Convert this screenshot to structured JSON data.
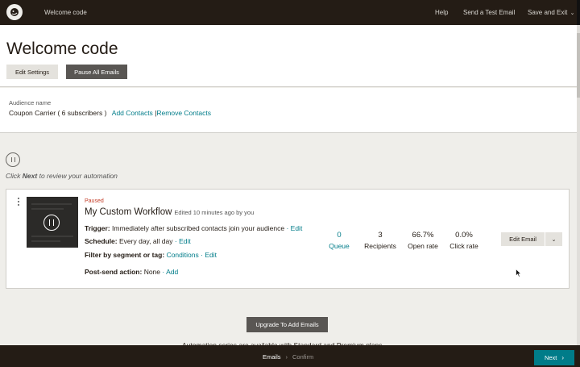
{
  "topbar": {
    "breadcrumb": "Welcome code",
    "help": "Help",
    "send_test": "Send a Test Email",
    "save_exit": "Save and Exit",
    "save_exit_chevron": "⌄"
  },
  "header": {
    "title": "Welcome code",
    "edit_settings": "Edit Settings",
    "pause_all": "Pause All Emails"
  },
  "audience": {
    "label": "Audience name",
    "name": "Coupon Carrier ( 6 subscribers )",
    "add_contacts": "Add Contacts",
    "divider": "|",
    "remove_contacts": "Remove Contacts"
  },
  "review": {
    "prefix": "Click ",
    "bold": "Next",
    "suffix": " to review your automation"
  },
  "email_card": {
    "status": "Paused",
    "title": "My Custom Workflow",
    "edited": "Edited 10 minutes ago by you",
    "trigger_label": "Trigger:",
    "trigger_value": "Immediately after subscribed contacts join your audience",
    "trigger_edit": "Edit",
    "schedule_label": "Schedule:",
    "schedule_value": "Every day, all day",
    "schedule_edit": "Edit",
    "filter_label": "Filter by segment or tag:",
    "filter_conditions": "Conditions",
    "filter_edit": "Edit",
    "post_send_label": "Post-send action:",
    "post_send_value": "None",
    "post_send_add": "Add",
    "separator": "·",
    "stats": [
      {
        "value": "0",
        "label": "Queue"
      },
      {
        "value": "3",
        "label": "Recipients"
      },
      {
        "value": "66.7%",
        "label": "Open rate"
      },
      {
        "value": "0.0%",
        "label": "Click rate"
      }
    ],
    "edit_email": "Edit Email",
    "dropdown_chevron": "⌄"
  },
  "upgrade_button": "Upgrade To Add Emails",
  "upgrade_note": "Automation series are available with Standard and Premium plans",
  "footer": {
    "step_emails": "Emails",
    "step_sep": "›",
    "step_confirm": "Confirm",
    "next": "Next",
    "next_chevron": "›"
  },
  "colors": {
    "accent": "#007c89",
    "dark": "#241c15",
    "paused": "#c5402b"
  }
}
